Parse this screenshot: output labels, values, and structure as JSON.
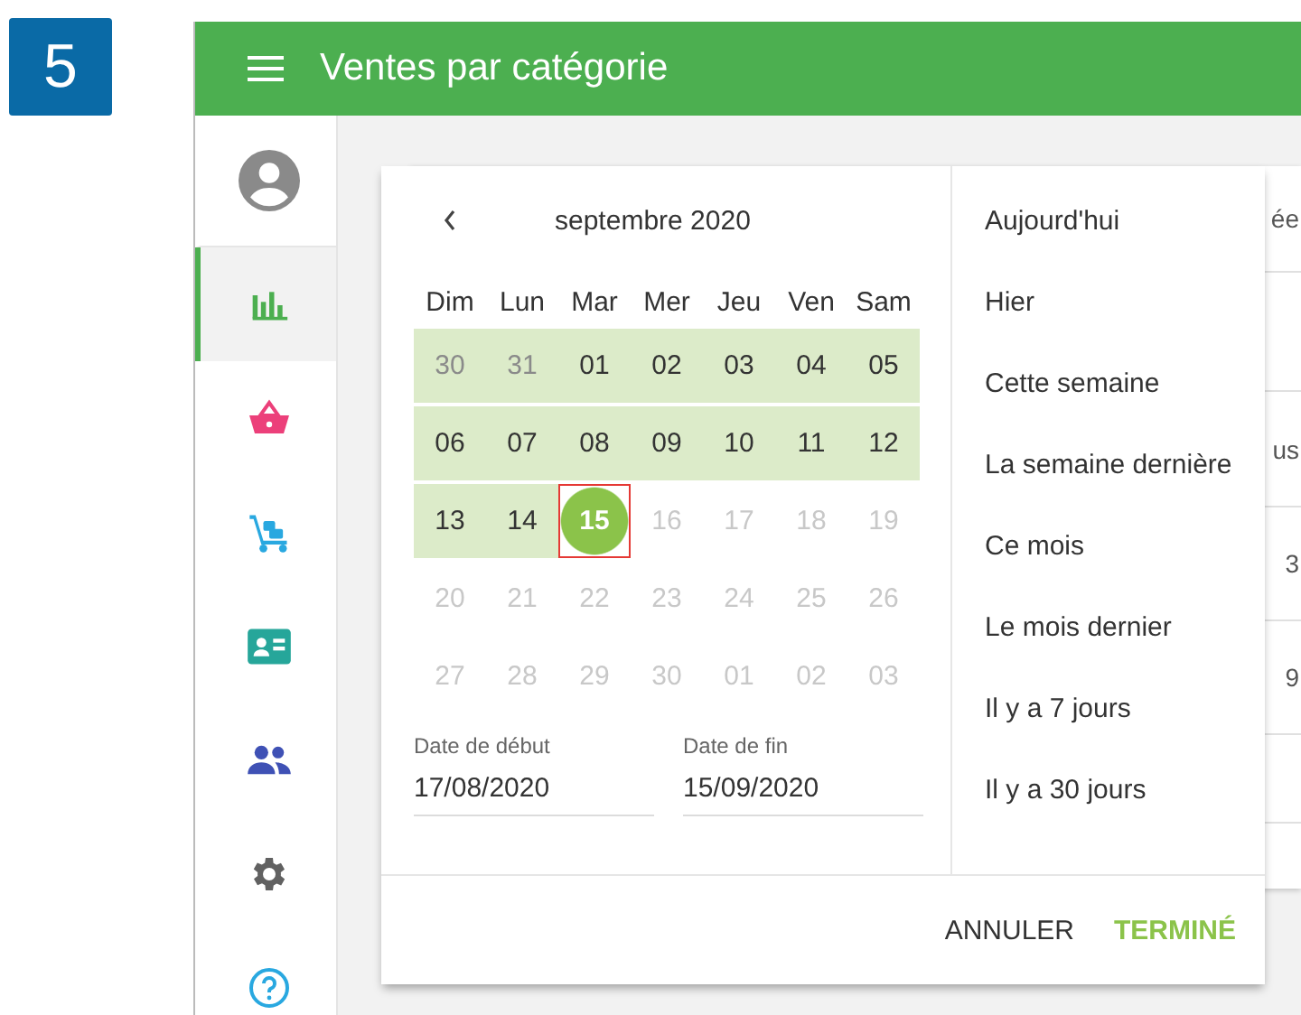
{
  "step_badge": "5",
  "header": {
    "title": "Ventes par catégorie"
  },
  "sidebar": {
    "items": [
      {
        "kind": "avatar",
        "selected": false
      },
      {
        "kind": "chart",
        "selected": true
      },
      {
        "kind": "basket",
        "selected": false
      },
      {
        "kind": "truck",
        "selected": false
      },
      {
        "kind": "card",
        "selected": false
      },
      {
        "kind": "people",
        "selected": false
      },
      {
        "kind": "gear",
        "selected": false
      },
      {
        "kind": "help",
        "selected": false
      }
    ]
  },
  "background_table": {
    "cells": [
      "ée",
      "us",
      "3",
      "9"
    ]
  },
  "calendar": {
    "month_title": "septembre 2020",
    "weekdays": [
      "Dim",
      "Lun",
      "Mar",
      "Mer",
      "Jeu",
      "Ven",
      "Sam"
    ],
    "weeks": [
      [
        {
          "text": "30",
          "kind": "adjacent",
          "in_range": true,
          "selected": false
        },
        {
          "text": "31",
          "kind": "adjacent",
          "in_range": true,
          "selected": false
        },
        {
          "text": "01",
          "kind": "day",
          "in_range": true,
          "selected": false
        },
        {
          "text": "02",
          "kind": "day",
          "in_range": true,
          "selected": false
        },
        {
          "text": "03",
          "kind": "day",
          "in_range": true,
          "selected": false
        },
        {
          "text": "04",
          "kind": "day",
          "in_range": true,
          "selected": false
        },
        {
          "text": "05",
          "kind": "day",
          "in_range": true,
          "selected": false
        }
      ],
      [
        {
          "text": "06",
          "kind": "day",
          "in_range": true,
          "selected": false
        },
        {
          "text": "07",
          "kind": "day",
          "in_range": true,
          "selected": false
        },
        {
          "text": "08",
          "kind": "day",
          "in_range": true,
          "selected": false
        },
        {
          "text": "09",
          "kind": "day",
          "in_range": true,
          "selected": false
        },
        {
          "text": "10",
          "kind": "day",
          "in_range": true,
          "selected": false
        },
        {
          "text": "11",
          "kind": "day",
          "in_range": true,
          "selected": false
        },
        {
          "text": "12",
          "kind": "day",
          "in_range": true,
          "selected": false
        }
      ],
      [
        {
          "text": "13",
          "kind": "day",
          "in_range": true,
          "selected": false
        },
        {
          "text": "14",
          "kind": "day",
          "in_range": true,
          "selected": false
        },
        {
          "text": "15",
          "kind": "day",
          "in_range": false,
          "selected": true
        },
        {
          "text": "16",
          "kind": "disabled",
          "in_range": false,
          "selected": false
        },
        {
          "text": "17",
          "kind": "disabled",
          "in_range": false,
          "selected": false
        },
        {
          "text": "18",
          "kind": "disabled",
          "in_range": false,
          "selected": false
        },
        {
          "text": "19",
          "kind": "disabled",
          "in_range": false,
          "selected": false
        }
      ],
      [
        {
          "text": "20",
          "kind": "disabled",
          "in_range": false,
          "selected": false
        },
        {
          "text": "21",
          "kind": "disabled",
          "in_range": false,
          "selected": false
        },
        {
          "text": "22",
          "kind": "disabled",
          "in_range": false,
          "selected": false
        },
        {
          "text": "23",
          "kind": "disabled",
          "in_range": false,
          "selected": false
        },
        {
          "text": "24",
          "kind": "disabled",
          "in_range": false,
          "selected": false
        },
        {
          "text": "25",
          "kind": "disabled",
          "in_range": false,
          "selected": false
        },
        {
          "text": "26",
          "kind": "disabled",
          "in_range": false,
          "selected": false
        }
      ],
      [
        {
          "text": "27",
          "kind": "disabled",
          "in_range": false,
          "selected": false
        },
        {
          "text": "28",
          "kind": "disabled",
          "in_range": false,
          "selected": false
        },
        {
          "text": "29",
          "kind": "disabled",
          "in_range": false,
          "selected": false
        },
        {
          "text": "30",
          "kind": "disabled",
          "in_range": false,
          "selected": false
        },
        {
          "text": "01",
          "kind": "disabled",
          "in_range": false,
          "selected": false
        },
        {
          "text": "02",
          "kind": "disabled",
          "in_range": false,
          "selected": false
        },
        {
          "text": "03",
          "kind": "disabled",
          "in_range": false,
          "selected": false
        }
      ]
    ]
  },
  "date_fields": [
    {
      "label": "Date de début",
      "value": "17/08/2020"
    },
    {
      "label": "Date de fin",
      "value": "15/09/2020"
    }
  ],
  "presets": [
    "Aujourd'hui",
    "Hier",
    "Cette semaine",
    "La semaine dernière",
    "Ce mois",
    "Le mois dernier",
    "Il y a 7 jours",
    "Il y a 30 jours"
  ],
  "buttons": [
    {
      "label": "ANNULER",
      "kind": "secondary"
    },
    {
      "label": "TERMINÉ",
      "kind": "primary"
    }
  ]
}
